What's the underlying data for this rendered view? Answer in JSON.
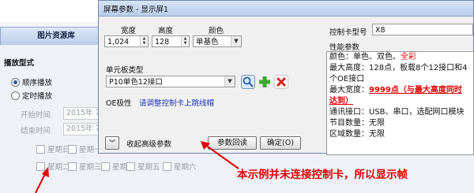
{
  "background": {
    "tab_title": "图片资源库",
    "section": "播放型式",
    "radio1": "顺序播放",
    "radio2": "定时播放",
    "start_label": "开始时间",
    "end_label": "结束时间",
    "start_value": "2015年 7月",
    "end_value": "2015年 7月",
    "weekdays": [
      "星期日",
      "星期一",
      "星期二",
      "星期三",
      "星期四",
      "星期五",
      "星期六"
    ]
  },
  "dialog": {
    "title": "屏幕参数 - 显示屏1",
    "width_label": "宽度",
    "height_label": "高度",
    "color_label": "颜色",
    "width_value": "1,024",
    "height_value": "128",
    "color_value": "单基色",
    "module_label": "单元板类型",
    "module_value": "P10单色12接口",
    "oe_label": "OE极性",
    "oe_link": "请调整控制卡上跳线帽",
    "controller_label": "控制卡型号",
    "controller_value": "X8",
    "perf_label": "性能参数",
    "perf": {
      "color_prefix": "颜色：单色、双色、",
      "color_full": "全彩",
      "max_height": "最大高度：128点，板载8个12接口和4",
      "max_height_2": "个OE接口",
      "max_width_prefix": "最大宽度：",
      "max_width_value": "9999点（与最大高度同时",
      "max_width_value_2": "达到）",
      "comm": "通讯接口：USB、串口，选配网口模块",
      "programs": "节目数量：无限",
      "areas": "区域数量：无限"
    },
    "collapse_label": "收起高级参数",
    "readback_label": "参数回读",
    "ok_label": "确定(O)"
  },
  "annotation": "本示例并未连接控制卡，所以显示帧",
  "colors": {
    "annotation": "#e00000",
    "title_bar": "#c6d9f0"
  }
}
